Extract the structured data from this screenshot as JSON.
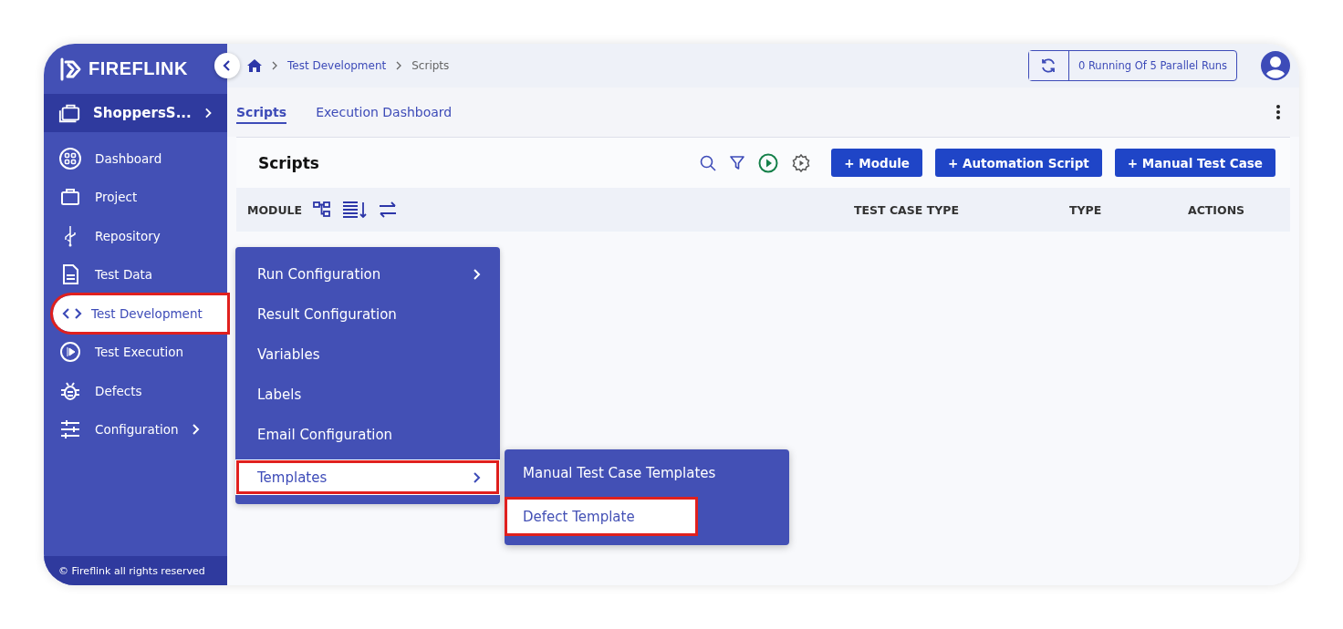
{
  "sidebar": {
    "logo": "FIREFLINK",
    "project": {
      "label": "ShoppersS..."
    },
    "items": [
      {
        "label": "Dashboard",
        "selected": false,
        "highlighted": false,
        "has_submenu": false
      },
      {
        "label": "Project",
        "selected": false,
        "highlighted": false,
        "has_submenu": false
      },
      {
        "label": "Repository",
        "selected": false,
        "highlighted": false,
        "has_submenu": false
      },
      {
        "label": "Test Data",
        "selected": false,
        "highlighted": false,
        "has_submenu": false
      },
      {
        "label": "Test Development",
        "selected": true,
        "highlighted": true,
        "has_submenu": false
      },
      {
        "label": "Test Execution",
        "selected": false,
        "highlighted": false,
        "has_submenu": false
      },
      {
        "label": "Defects",
        "selected": false,
        "highlighted": false,
        "has_submenu": false
      },
      {
        "label": "Configuration",
        "selected": false,
        "highlighted": false,
        "has_submenu": true
      }
    ],
    "footer": "© Fireflink all rights reserved"
  },
  "breadcrumb": [
    "Test Development",
    "Scripts"
  ],
  "parallel_runs": "0 Running Of 5 Parallel Runs",
  "tabs": [
    {
      "label": "Scripts",
      "selected": true
    },
    {
      "label": "Execution Dashboard",
      "selected": false
    }
  ],
  "panel": {
    "title": "Scripts",
    "buttons": [
      "+ Module",
      "+ Automation Script",
      "+ Manual Test Case"
    ]
  },
  "table": {
    "columns": [
      "MODULE",
      "TEST CASE TYPE",
      "TYPE",
      "ACTIONS"
    ]
  },
  "menu": {
    "items": [
      {
        "label": "Run Configuration",
        "has_submenu": true,
        "selected": false,
        "highlighted": false
      },
      {
        "label": "Result Configuration",
        "has_submenu": false,
        "selected": false,
        "highlighted": false
      },
      {
        "label": "Variables",
        "has_submenu": false,
        "selected": false,
        "highlighted": false
      },
      {
        "label": "Labels",
        "has_submenu": false,
        "selected": false,
        "highlighted": false
      },
      {
        "label": "Email Configuration",
        "has_submenu": false,
        "selected": false,
        "highlighted": false
      },
      {
        "label": "Templates",
        "has_submenu": true,
        "selected": true,
        "highlighted": true
      }
    ]
  },
  "submenu": {
    "items": [
      {
        "label": "Manual Test Case Templates",
        "selected": false,
        "highlighted": false
      },
      {
        "label": "Defect Template",
        "selected": true,
        "highlighted": true
      }
    ]
  }
}
